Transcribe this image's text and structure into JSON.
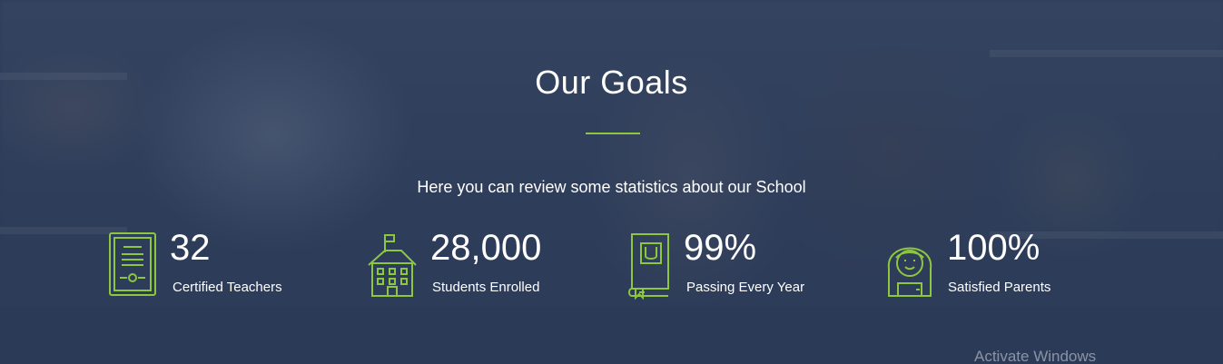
{
  "section": {
    "title": "Our Goals",
    "subtitle": "Here you can review some statistics about our School"
  },
  "stats": [
    {
      "icon": "certificate-icon",
      "value": "32",
      "label": "Certified Teachers"
    },
    {
      "icon": "school-building-icon",
      "value": "28,000",
      "label": "Students Enrolled"
    },
    {
      "icon": "book-icon",
      "value": "99%",
      "label": "Passing Every Year"
    },
    {
      "icon": "parent-face-icon",
      "value": "100%",
      "label": "Satisfied Parents"
    }
  ],
  "system": {
    "watermark": "Activate Windows"
  },
  "colors": {
    "accent": "#8dc63f",
    "overlay": "#2e3f5e",
    "text": "#ffffff"
  }
}
